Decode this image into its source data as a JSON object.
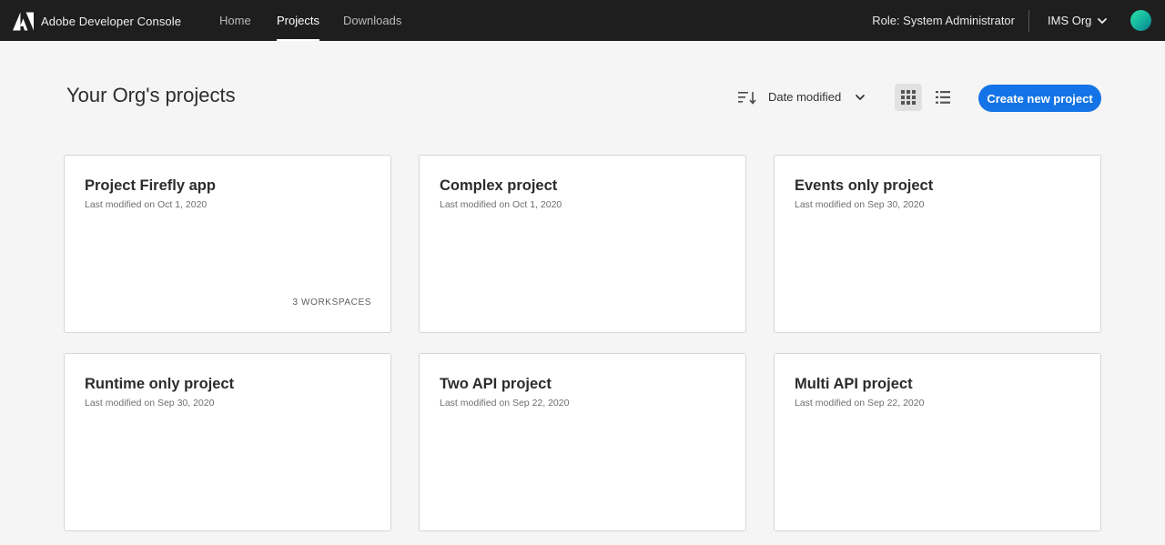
{
  "header": {
    "brand": "Adobe Developer Console",
    "nav": [
      {
        "label": "Home",
        "active": false
      },
      {
        "label": "Projects",
        "active": true
      },
      {
        "label": "Downloads",
        "active": false
      }
    ],
    "role": "Role: System Administrator",
    "org": "IMS Org",
    "icons": {
      "logo": "adobe-logo-icon",
      "org_dropdown": "chevron-down-icon",
      "avatar": "user-avatar"
    }
  },
  "toolbar": {
    "title": "Your Org's projects",
    "sort_label": "Date modified",
    "create_label": "Create new project",
    "icons": {
      "sort": "sort-order-icon",
      "sort_dropdown": "chevron-down-icon",
      "grid_view": "grid-view-icon",
      "list_view": "list-view-icon"
    }
  },
  "projects": [
    {
      "title": "Project Firefly app",
      "modified": "Last modified on Oct 1, 2020",
      "workspaces": "3 WORKSPACES"
    },
    {
      "title": "Complex project",
      "modified": "Last modified on Oct 1, 2020",
      "workspaces": ""
    },
    {
      "title": "Events only project",
      "modified": "Last modified on Sep 30, 2020",
      "workspaces": ""
    },
    {
      "title": "Runtime only project",
      "modified": "Last modified on Sep 30, 2020",
      "workspaces": ""
    },
    {
      "title": "Two API project",
      "modified": "Last modified on Sep 22, 2020",
      "workspaces": ""
    },
    {
      "title": "Multi API project",
      "modified": "Last modified on Sep 22, 2020",
      "workspaces": ""
    }
  ],
  "colors": {
    "header_bg": "#1e1e1e",
    "page_bg": "#f5f5f5",
    "accent": "#1473e6",
    "card_border": "#d6d6d6"
  }
}
